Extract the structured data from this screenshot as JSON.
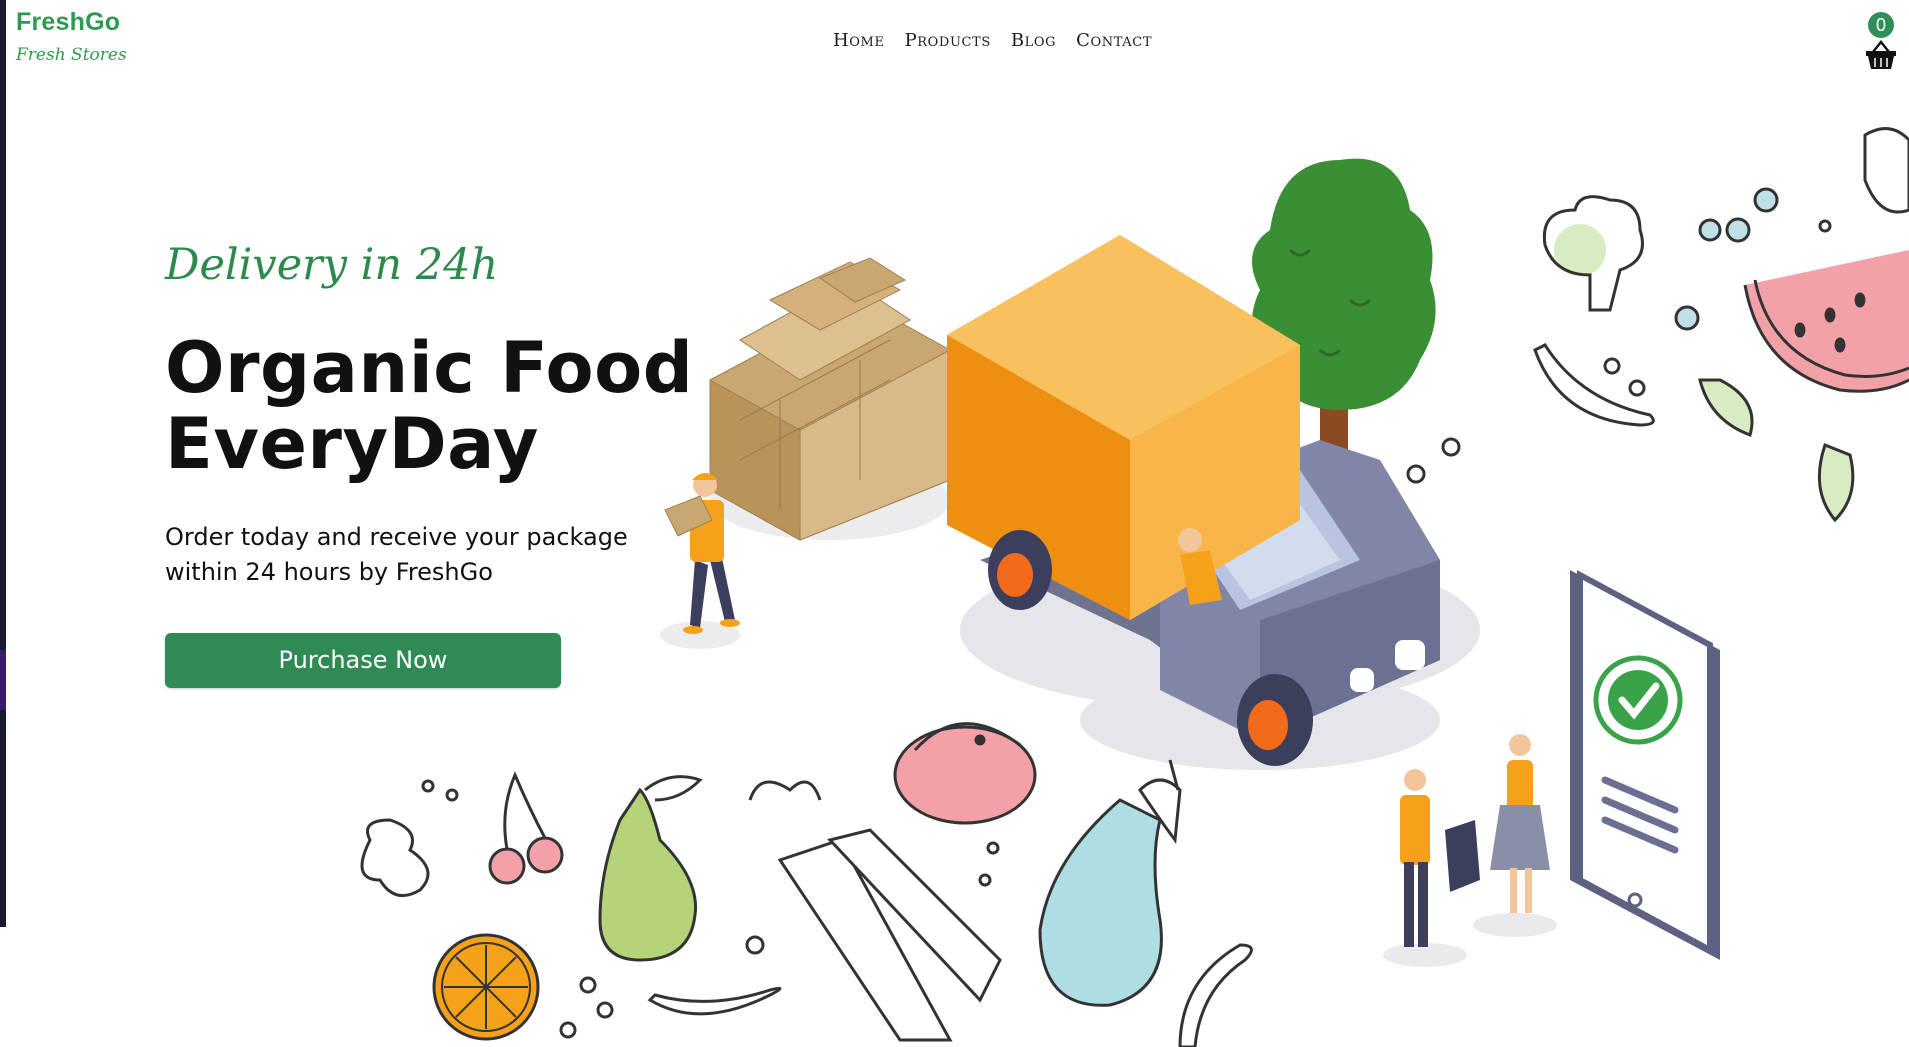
{
  "brand": {
    "name": "FreshGo",
    "tagline": "Fresh Stores"
  },
  "nav": {
    "items": [
      "Home",
      "Products",
      "Blog",
      "Contact"
    ]
  },
  "cart": {
    "count": "0"
  },
  "hero": {
    "script": "Delivery in 24h",
    "title_line1": "Organic Food",
    "title_line2": "EveryDay",
    "subtitle_line1": "Order today and receive your package",
    "subtitle_line2": "within 24 hours by FreshGo",
    "cta": "Purchase Now"
  },
  "colors": {
    "brand_green": "#2d9b4e",
    "button_green": "#2f8a55",
    "truck_orange": "#f5a21a",
    "truck_body": "#7b7f9e"
  },
  "icons": [
    "basket-icon",
    "checkmark-icon"
  ]
}
